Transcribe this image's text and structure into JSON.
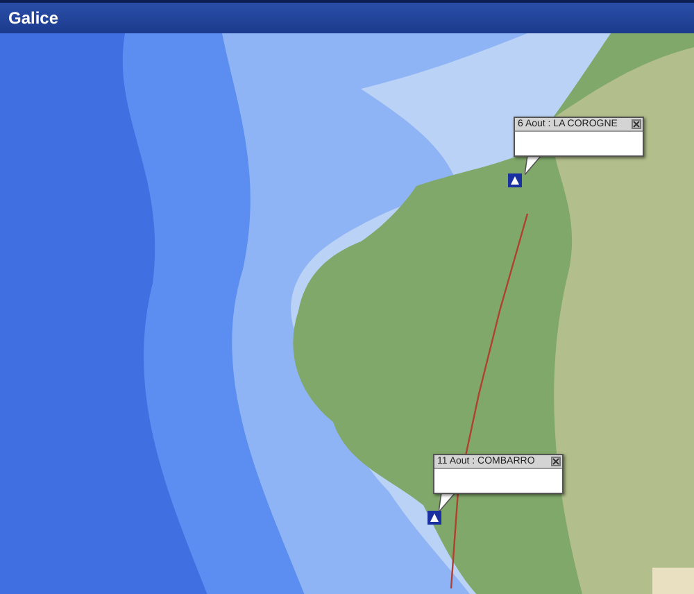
{
  "window": {
    "title": "Galice"
  },
  "markers": [
    {
      "label": "6 Aout : LA COROGNE"
    },
    {
      "label": "11 Aout : COMBARRO"
    }
  ]
}
